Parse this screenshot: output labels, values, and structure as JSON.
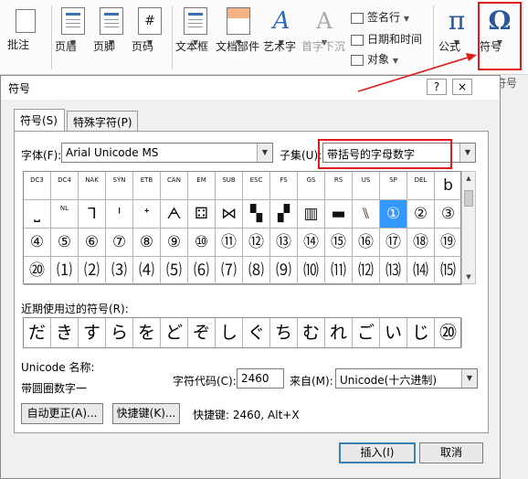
{
  "ribbon": {
    "comment": "批注",
    "header": "页眉",
    "footer": "页脚",
    "page_number": "页码",
    "text_box": "文本框",
    "quick_parts": "文档部件",
    "wordart": "艺术字",
    "drop_cap": "首字下沉",
    "signature_line": "签名行",
    "date_time": "日期和时间",
    "object": "对象",
    "equation": "公式",
    "symbol": "符号",
    "symbol_group": "符号",
    "equation_glyph": "π",
    "symbol_glyph": "Ω",
    "wordart_glyph": "A",
    "drop_cap_glyph": "A",
    "page_number_glyph": "#"
  },
  "dialog": {
    "title": "符号",
    "help": "?",
    "close": "×",
    "tabs": [
      "符号(S)",
      "特殊字符(P)"
    ],
    "font_label": "字体(F):",
    "font_value": "Arial Unicode MS",
    "subset_label": "子集(U):",
    "subset_value": "带括号的字母数字",
    "grid": {
      "row1": [
        "DC3",
        "DC4",
        "NAK",
        "SYN",
        "ETB",
        "CAN",
        "EM",
        "SUB",
        "ESC",
        "FS",
        "GS",
        "RS",
        "US",
        "SP",
        "DEL",
        "b"
      ],
      "row2": [
        "⎵",
        "NL",
        "ᒣ",
        "ᑊ",
        "ᐩ",
        "ᗅ",
        "⚃",
        "⋈",
        "▚",
        "▞",
        "▥",
        "▬",
        "⑊",
        "①",
        "②",
        "③"
      ],
      "row3": [
        "④",
        "⑤",
        "⑥",
        "⑦",
        "⑧",
        "⑨",
        "⑩",
        "⑪",
        "⑫",
        "⑬",
        "⑭",
        "⑮",
        "⑯",
        "⑰",
        "⑱",
        "⑲"
      ],
      "row4": [
        "⑳",
        "⑴",
        "⑵",
        "⑶",
        "⑷",
        "⑸",
        "⑹",
        "⑺",
        "⑻",
        "⑼",
        "⑽",
        "⑾",
        "⑿",
        "⒀",
        "⒁",
        "⒂"
      ]
    },
    "recent_label": "近期使用过的符号(R):",
    "recent": [
      "だ",
      "き",
      "す",
      "ら",
      "を",
      "ど",
      "ぞ",
      "し",
      "ぐ",
      "ち",
      "む",
      "れ",
      "ご",
      "い",
      "じ",
      "⑳"
    ],
    "unicode_name_label": "Unicode 名称:",
    "unicode_name_value": "带圆圈数字一",
    "char_code_label": "字符代码(C):",
    "char_code_value": "2460",
    "from_label": "来自(M):",
    "from_value": "Unicode(十六进制)",
    "autocorrect": "自动更正(A)...",
    "shortcut_key": "快捷键(K)...",
    "shortcut_info": "快捷键: 2460, Alt+X",
    "insert": "插入(I)",
    "cancel": "取消"
  },
  "colors": {
    "highlight": "#e01b1b",
    "selection": "#3399ff",
    "accent": "#2b579a"
  }
}
